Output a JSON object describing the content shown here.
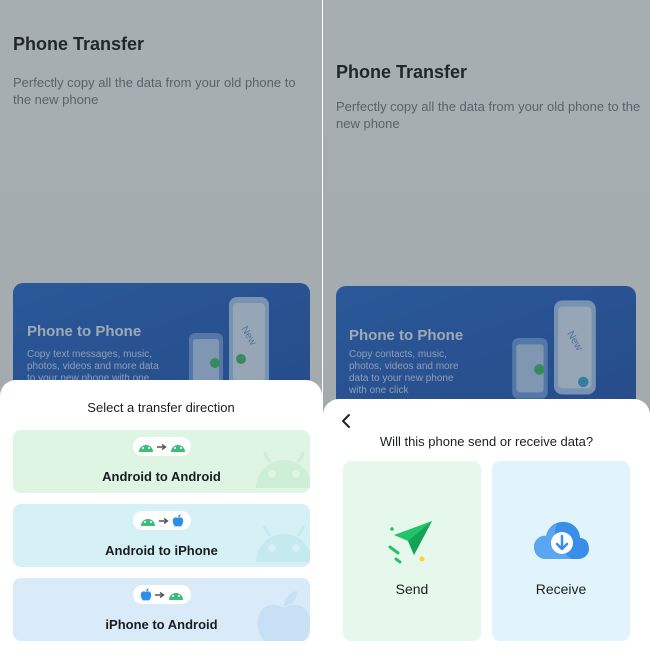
{
  "left": {
    "app_title": "Phone Transfer",
    "app_subtitle": "Perfectly copy all the data from your old phone to the new phone",
    "feature_card": {
      "title": "Phone to Phone",
      "description": "Copy text messages, music, photos, videos and more data to your new phone with one"
    },
    "sheet": {
      "title": "Select a transfer direction",
      "options": [
        {
          "label": "Android to Android",
          "from": "android-icon",
          "to": "android-icon",
          "bg": "#dff5e4",
          "deco": "android-icon"
        },
        {
          "label": "Android to iPhone",
          "from": "android-icon",
          "to": "apple-icon",
          "bg": "#d5f1f5",
          "deco": "android-icon"
        },
        {
          "label": "iPhone to Android",
          "from": "apple-icon",
          "to": "android-icon",
          "bg": "#d9eaf9",
          "deco": "apple-icon"
        }
      ]
    }
  },
  "right": {
    "app_title": "Phone Transfer",
    "app_subtitle": "Perfectly copy all the data from your old phone to the new phone",
    "feature_card": {
      "title": "Phone to Phone",
      "description": "Copy contacts, music, photos, videos and more data to your new phone with one click"
    },
    "sheet": {
      "title": "Will this phone send or receive data?",
      "send_label": "Send",
      "receive_label": "Receive"
    }
  },
  "colors": {
    "android_green": "#3dbd7a",
    "apple_blue": "#2f8fe8",
    "send_green": "#22c36a",
    "receive_blue": "#3a8ee8",
    "send_bg": "#e6f8ec",
    "receive_bg": "#e2f4fb"
  }
}
